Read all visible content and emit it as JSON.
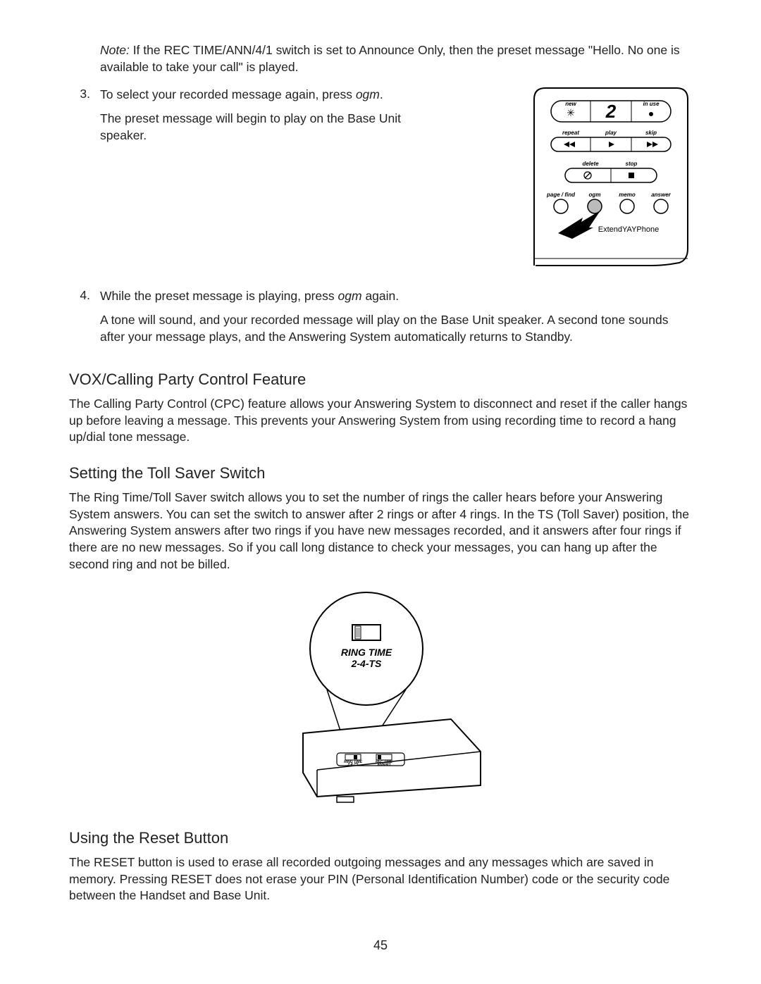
{
  "note": {
    "label": "Note:",
    "text": " If the REC TIME/ANN/4/1 switch is set to Announce Only, then the preset message \"Hello. No one is available to take your call\" is played."
  },
  "steps": {
    "3": {
      "num": "3.",
      "text_a": "To select your recorded message again, press ",
      "ogm": "ogm",
      "text_b": ".",
      "sub": "The preset message will begin to play on the Base Unit speaker."
    },
    "4": {
      "num": "4.",
      "text_a": "While the preset message is playing, press ",
      "ogm": "ogm",
      "text_b": " again.",
      "sub": "A tone will sound, and your recorded message will play on the Base Unit speaker. A second tone sounds after your message plays, and the Answering System automatically returns to Standby."
    }
  },
  "sections": {
    "vox": {
      "heading": "VOX/Calling Party Control Feature",
      "body_a": "The Calling Party Control (",
      "cpc": "CPC",
      "body_b": ") feature allows your Answering System to disconnect and reset if the caller hangs up before leaving a message. This prevents your Answering System from using recording time to record a hang up/dial tone message."
    },
    "toll": {
      "heading": "Setting the Toll Saver Switch",
      "body": "The Ring Time/Toll Saver switch allows you to set the number of rings the caller hears before your Answering System answers. You can set the switch to answer after 2 rings or after 4 rings. In the TS (Toll Saver) position, the Answering System answers after two rings if you have new messages recorded, and it answers after four rings if there are no new messages. So if you call long distance to check your messages, you can hang up after the second ring and not be billed."
    },
    "reset": {
      "heading": "Using the Reset Button",
      "body_a": "The RESET button is used to erase all recorded outgoing messages and any messages which are saved in memory. Pressing RESET does not erase your ",
      "pin": "PIN",
      "body_b": " (Personal Identification Number) code or the security code between the Handset and Base Unit."
    }
  },
  "page_number": "45",
  "figures": {
    "base_panel": {
      "new": "new",
      "in_use": "in use",
      "display_value": "2",
      "repeat": "repeat",
      "play": "play",
      "skip": "skip",
      "delete": "delete",
      "stop": "stop",
      "page_find": "page / find",
      "ogm": "ogm",
      "memo": "memo",
      "answer": "answer",
      "brand": "ExtendYAYPhone"
    },
    "ring_time": {
      "label1": "RING TIME",
      "label2": "2-4-TS",
      "sw1a": "RING TIME",
      "sw1b": "2-4-TS",
      "sw2a": "REC TIME",
      "sw2b": "ANN/4/1"
    }
  }
}
